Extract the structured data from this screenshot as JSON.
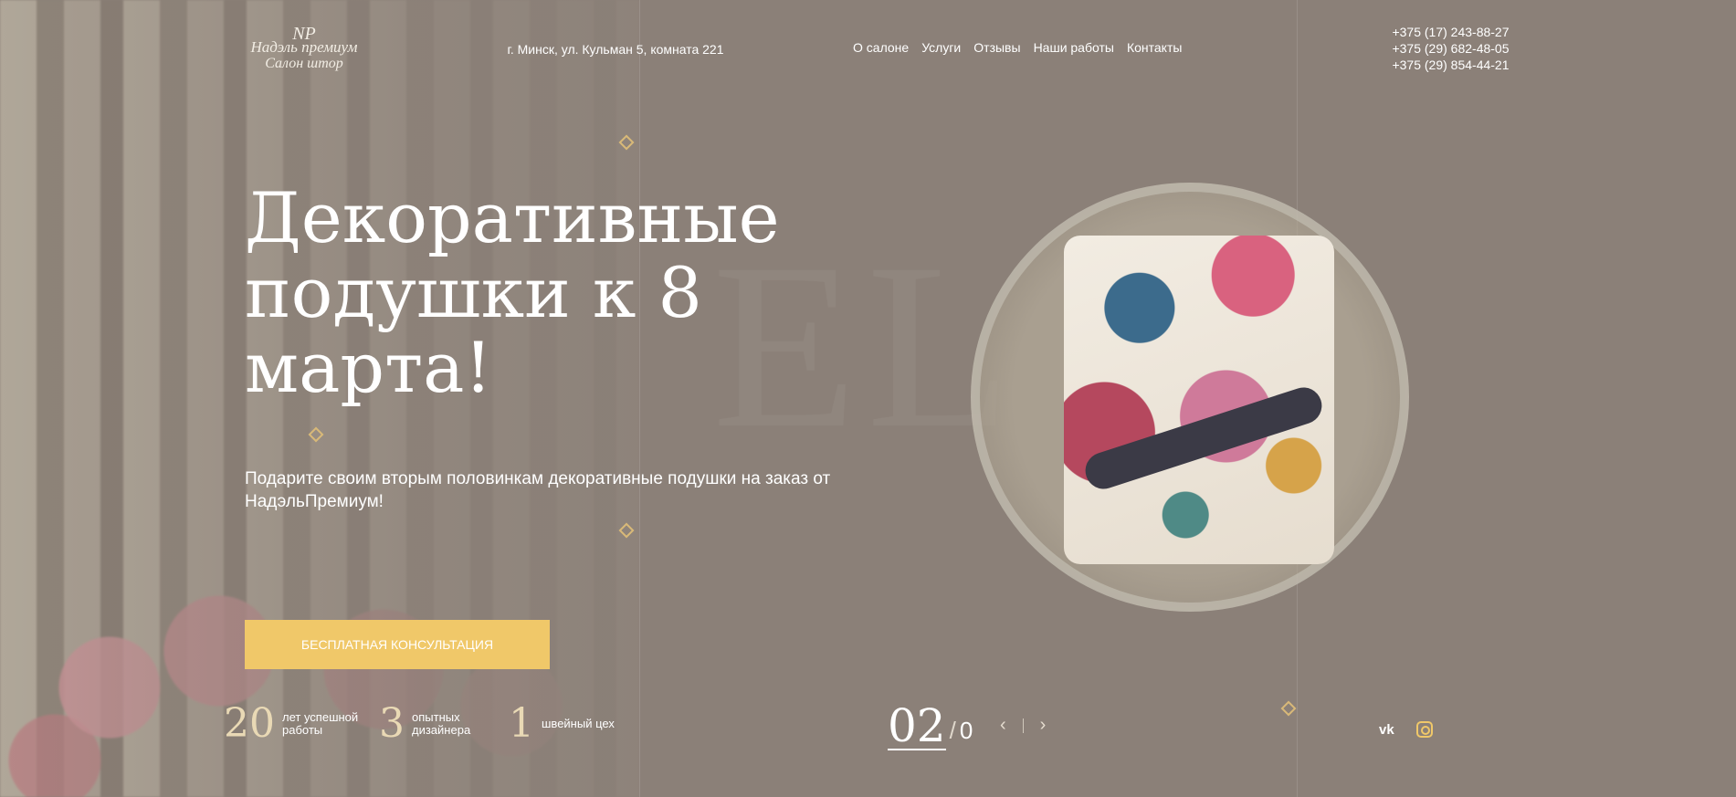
{
  "brand": {
    "monogram": "NP",
    "line1": "Надэль премиум",
    "line2": "Салон штор"
  },
  "header": {
    "address": "г. Минск, ул. Кульман 5, комната 221",
    "nav": [
      "О салоне",
      "Услуги",
      "Отзывы",
      "Наши работы",
      "Контакты"
    ],
    "phones": [
      "+375 (17) 243-88-27",
      "+375 (29) 682-48-05",
      "+375 (29) 854-44-21"
    ]
  },
  "hero": {
    "title": "Декоративные подушки к 8 марта!",
    "subtitle": "Подарите своим вторым половинкам декоративные подушки на заказ от НадэльПремиум!",
    "cta": "БЕСПЛАТНАЯ КОНСУЛЬТАЦИЯ"
  },
  "stats": [
    {
      "num": "20",
      "label": "лет успешной работы"
    },
    {
      "num": "3",
      "label": "опытных дизайнера"
    },
    {
      "num": "1",
      "label": "швейный цех"
    }
  ],
  "slider": {
    "current": "02",
    "separator": "/",
    "total": "0",
    "prev_icon": "‹",
    "next_icon": "›"
  },
  "social": {
    "vk": "vk",
    "instagram_icon": "instagram-icon"
  },
  "colors": {
    "accent": "#f0c869",
    "background": "#8b8078"
  }
}
